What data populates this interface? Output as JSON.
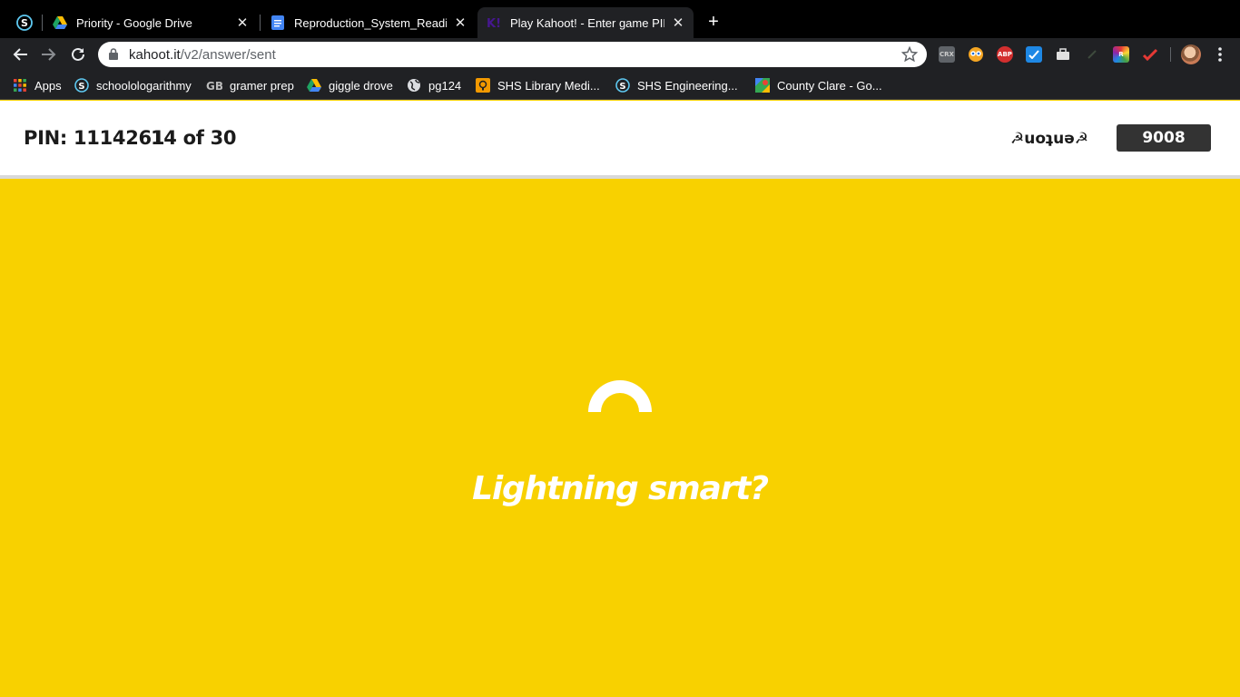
{
  "browser": {
    "tabs": [
      {
        "title": "Priority - Google Drive",
        "icon": "google-drive-icon"
      },
      {
        "title": "Reproduction_System_Reading",
        "icon": "google-docs-icon"
      },
      {
        "title": "Play Kahoot! - Enter game PIN",
        "icon": "kahoot-icon",
        "active": true
      }
    ],
    "pinned_tab_icon": "schoology-icon",
    "address": {
      "host": "kahoot.it",
      "path": "/v2/answer/sent"
    },
    "extensions": [
      "crx-icon",
      "owl-icon",
      "adblock-plus-icon",
      "extension-blue-icon",
      "briefcase-icon",
      "extension-dark-icon",
      "colorful-extension-icon",
      "red-check-icon"
    ],
    "bookmarks": [
      {
        "label": "Apps",
        "icon": "apps-grid-icon"
      },
      {
        "label": "schoolologarithmy",
        "icon": "schoology-icon"
      },
      {
        "label": "gramer prep",
        "icon": "gb-icon"
      },
      {
        "label": "giggle drove",
        "icon": "google-drive-icon"
      },
      {
        "label": "pg124",
        "icon": "globe-icon"
      },
      {
        "label": "SHS Library Medi...",
        "icon": "library-icon"
      },
      {
        "label": "SHS Engineering...",
        "icon": "schoology-icon"
      },
      {
        "label": "County Clare - Go...",
        "icon": "google-maps-icon"
      }
    ]
  },
  "game": {
    "pin_label": "PIN: 1114261",
    "progress": "14 of 30",
    "nickname": "☭uoʇuǝ☭",
    "score": "9008"
  },
  "main": {
    "message": "Lightning smart?"
  },
  "colors": {
    "background": "#f8d100",
    "header": "#ffffff",
    "score_box": "#333333",
    "chrome_dark": "#202124"
  }
}
